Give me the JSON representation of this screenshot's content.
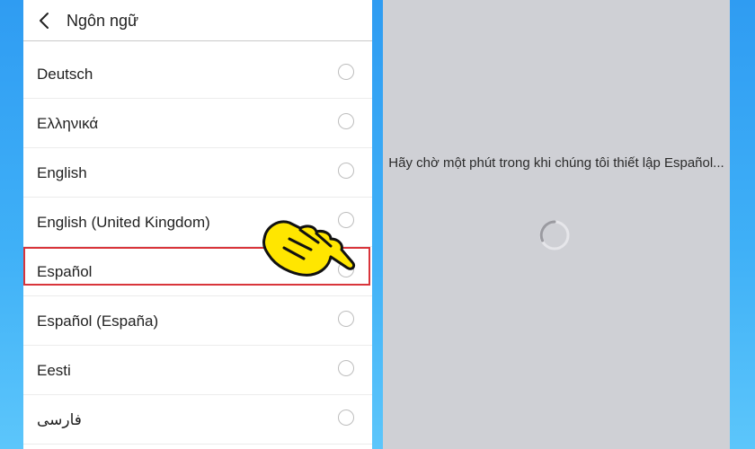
{
  "header": {
    "title": "Ngôn ngữ",
    "back_icon": "chevron-left-icon"
  },
  "languages": [
    {
      "label": "Deutsch",
      "selected": false
    },
    {
      "label": "Ελληνικά",
      "selected": false
    },
    {
      "label": "English",
      "selected": false
    },
    {
      "label": "English (United Kingdom)",
      "selected": false
    },
    {
      "label": "Español",
      "selected": false,
      "highlighted": true
    },
    {
      "label": "Español (España)",
      "selected": false
    },
    {
      "label": "Eesti",
      "selected": false
    },
    {
      "label": "فارسی",
      "selected": false
    }
  ],
  "setup_dialog": {
    "message": "Hãy chờ một phút trong khi chúng tôi thiết lập Español...",
    "spinner_icon": "loading-spinner-icon"
  },
  "annotation": {
    "pointer_icon": "pointing-hand-icon",
    "highlight_color": "#d9353b"
  },
  "colors": {
    "background": "#3fa8f5",
    "right_panel": "#cfd0d5",
    "list_bg": "#ffffff"
  }
}
